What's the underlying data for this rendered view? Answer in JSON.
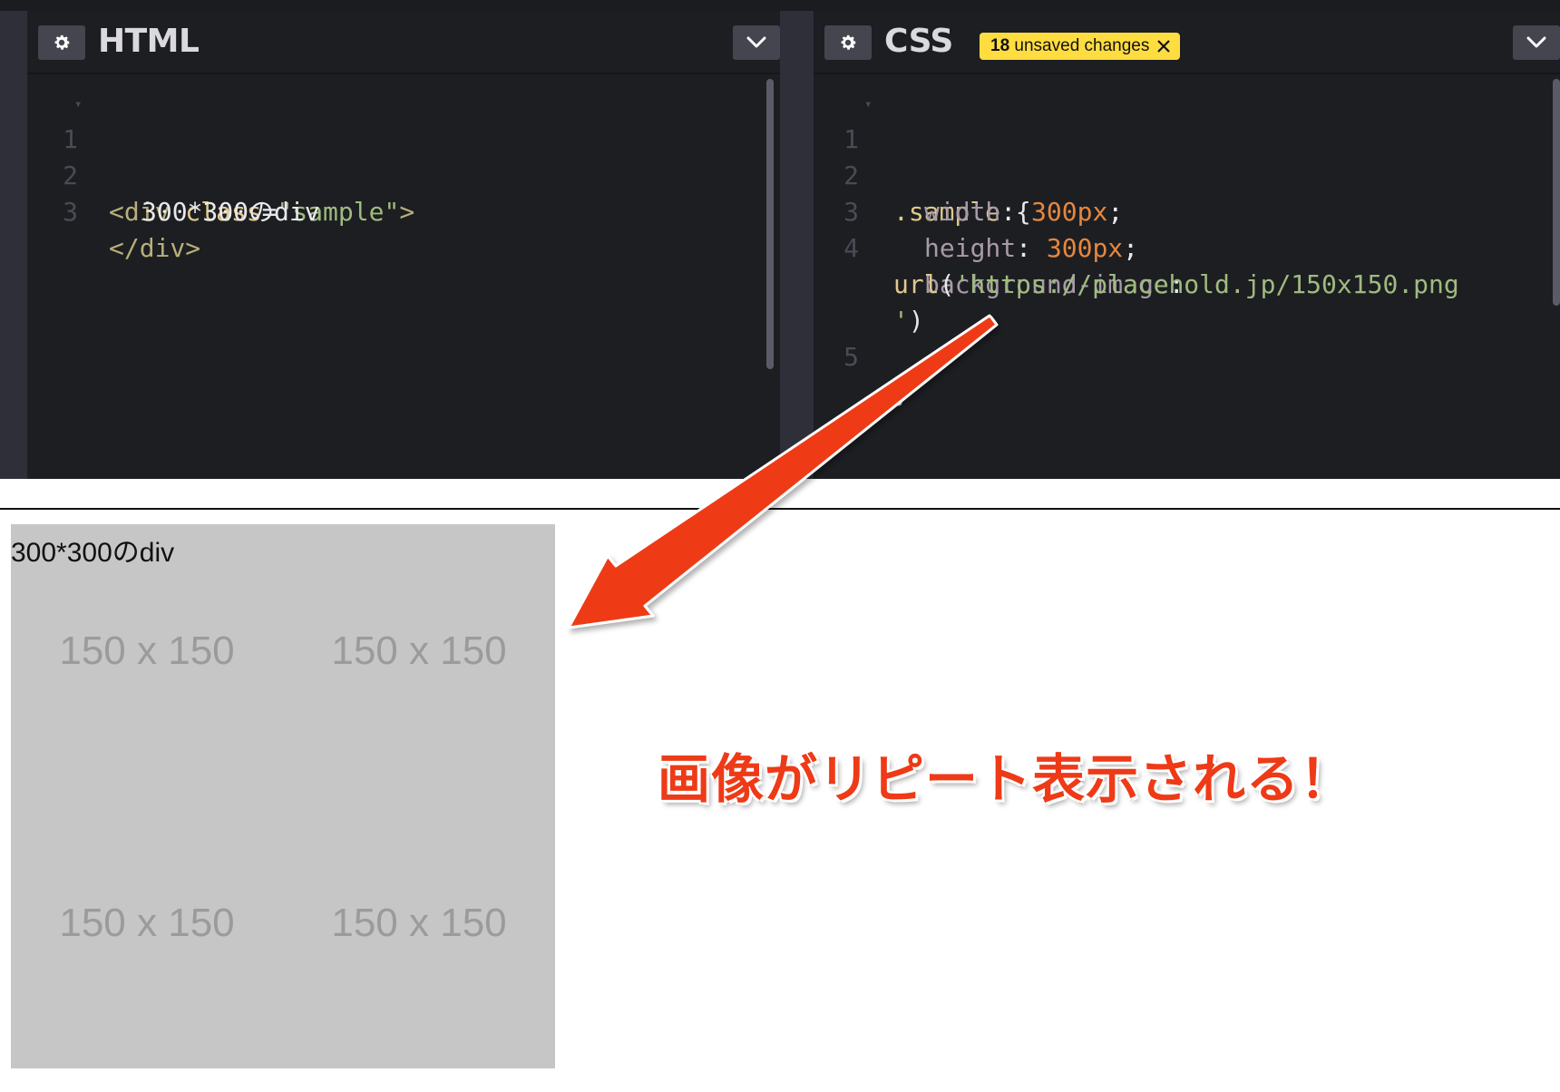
{
  "html_panel": {
    "title": "HTML",
    "gear_icon": "gear-icon",
    "chevron_icon": "chevron-down-icon",
    "lines": [
      {
        "num": "1",
        "tag_open": "<div ",
        "attr": "class",
        "eq": "=",
        "str": "\"sample\"",
        "tag_close": ">"
      },
      {
        "num": "2",
        "text": "300*300のdiv"
      },
      {
        "num": "3",
        "tag": "</div>"
      }
    ]
  },
  "css_panel": {
    "title": "CSS",
    "unsaved": {
      "count": "18",
      "label": "unsaved changes"
    },
    "lines": [
      {
        "num": "1",
        "selector": ".sample",
        "brace": " {"
      },
      {
        "num": "2",
        "prop": "width",
        "colon": ": ",
        "value": "300px",
        "semi": ";"
      },
      {
        "num": "3",
        "prop": "height",
        "colon": ": ",
        "value": "300px",
        "semi": ";"
      },
      {
        "num": "4",
        "prop": "background-image",
        "colon": ":"
      },
      {
        "num": "",
        "fn": "url",
        "paren": "(",
        "str": "'https://placehold.jp/150x150.png"
      },
      {
        "num": "",
        "str": "'",
        "paren": ")"
      },
      {
        "num": "5",
        "brace": "}"
      }
    ]
  },
  "preview": {
    "div_text": "300*300のdiv",
    "tile_label": "150 x 150",
    "tile_color": "#c6c6c6"
  },
  "annotation": {
    "callout": "画像がリピート表示される！",
    "arrow_color": "#ee3a17"
  },
  "colors": {
    "editor_bg": "#1d1e22",
    "badge_bg": "#ffdd40"
  }
}
